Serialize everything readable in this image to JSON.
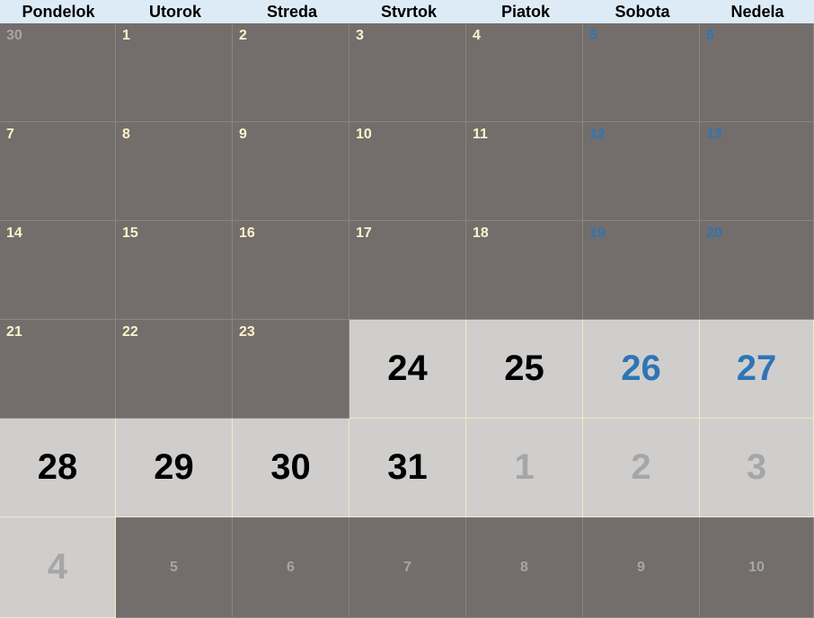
{
  "weekdays": [
    "Pondelok",
    "Utorok",
    "Streda",
    "Stvrtok",
    "Piatok",
    "Sobota",
    "Nedela"
  ],
  "weeks": [
    [
      {
        "day": "30",
        "style": "muted"
      },
      {
        "day": "1",
        "style": "normal"
      },
      {
        "day": "2",
        "style": "normal"
      },
      {
        "day": "3",
        "style": "normal"
      },
      {
        "day": "4",
        "style": "normal"
      },
      {
        "day": "5",
        "style": "weekend"
      },
      {
        "day": "6",
        "style": "weekend"
      }
    ],
    [
      {
        "day": "7",
        "style": "normal"
      },
      {
        "day": "8",
        "style": "normal"
      },
      {
        "day": "9",
        "style": "normal"
      },
      {
        "day": "10",
        "style": "normal"
      },
      {
        "day": "11",
        "style": "normal"
      },
      {
        "day": "12",
        "style": "weekend"
      },
      {
        "day": "13",
        "style": "weekend"
      }
    ],
    [
      {
        "day": "14",
        "style": "normal"
      },
      {
        "day": "15",
        "style": "normal"
      },
      {
        "day": "16",
        "style": "normal"
      },
      {
        "day": "17",
        "style": "normal"
      },
      {
        "day": "18",
        "style": "normal"
      },
      {
        "day": "19",
        "style": "weekend"
      },
      {
        "day": "20",
        "style": "weekend"
      }
    ],
    [
      {
        "day": "21",
        "style": "normal"
      },
      {
        "day": "22",
        "style": "normal"
      },
      {
        "day": "23",
        "style": "normal"
      },
      {
        "day": "24",
        "style": "hl"
      },
      {
        "day": "25",
        "style": "hl"
      },
      {
        "day": "26",
        "style": "hl weekend"
      },
      {
        "day": "27",
        "style": "hl weekend"
      }
    ],
    [
      {
        "day": "28",
        "style": "hl"
      },
      {
        "day": "29",
        "style": "hl"
      },
      {
        "day": "30",
        "style": "hl"
      },
      {
        "day": "31",
        "style": "hl"
      },
      {
        "day": "1",
        "style": "hl muted"
      },
      {
        "day": "2",
        "style": "hl muted"
      },
      {
        "day": "3",
        "style": "hl muted"
      }
    ],
    [
      {
        "day": "4",
        "style": "hl muted"
      },
      {
        "day": "5",
        "style": "dim"
      },
      {
        "day": "6",
        "style": "dim"
      },
      {
        "day": "7",
        "style": "dim"
      },
      {
        "day": "8",
        "style": "dim"
      },
      {
        "day": "9",
        "style": "dim"
      },
      {
        "day": "10",
        "style": "dim"
      }
    ]
  ],
  "colors": {
    "header_bg": "#ddebf7",
    "cell_bg": "#736e6b",
    "highlight_bg": "#d0cecd",
    "day_text": "#fff2cc",
    "weekend_text": "#2e75b6",
    "muted_text": "#a6a6a6"
  }
}
